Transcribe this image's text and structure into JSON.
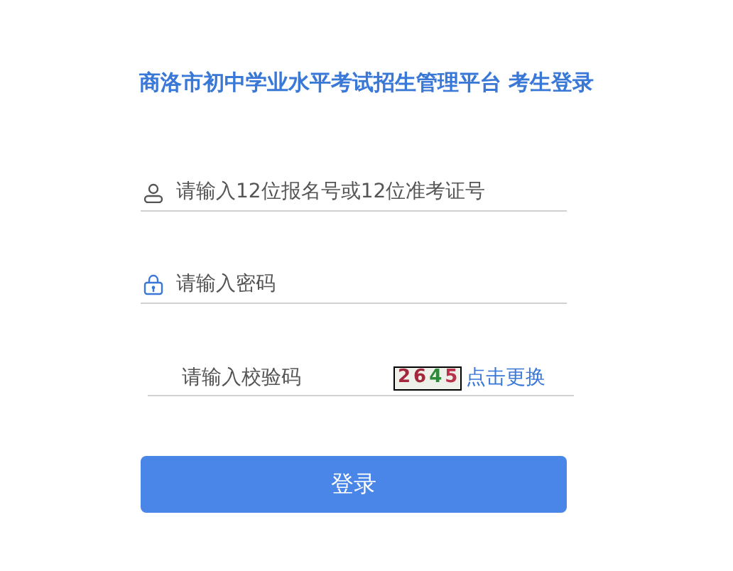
{
  "title": "商洛市初中学业水平考试招生管理平台 考生登录",
  "fields": [
    {
      "kind": "user",
      "placeholder": "请输入12位报名号或12位准考证号"
    },
    {
      "kind": "password",
      "placeholder": "请输入密码"
    }
  ],
  "captcha": {
    "placeholder": "请输入校验码",
    "digits": [
      {
        "text": "2",
        "color": "#a3283c"
      },
      {
        "text": "6",
        "color": "#a3283c"
      },
      {
        "text": "4",
        "color": "#2e8b3a"
      },
      {
        "text": "5",
        "color": "#b8324a"
      }
    ],
    "refresh": "点击更换"
  },
  "button": "登录"
}
